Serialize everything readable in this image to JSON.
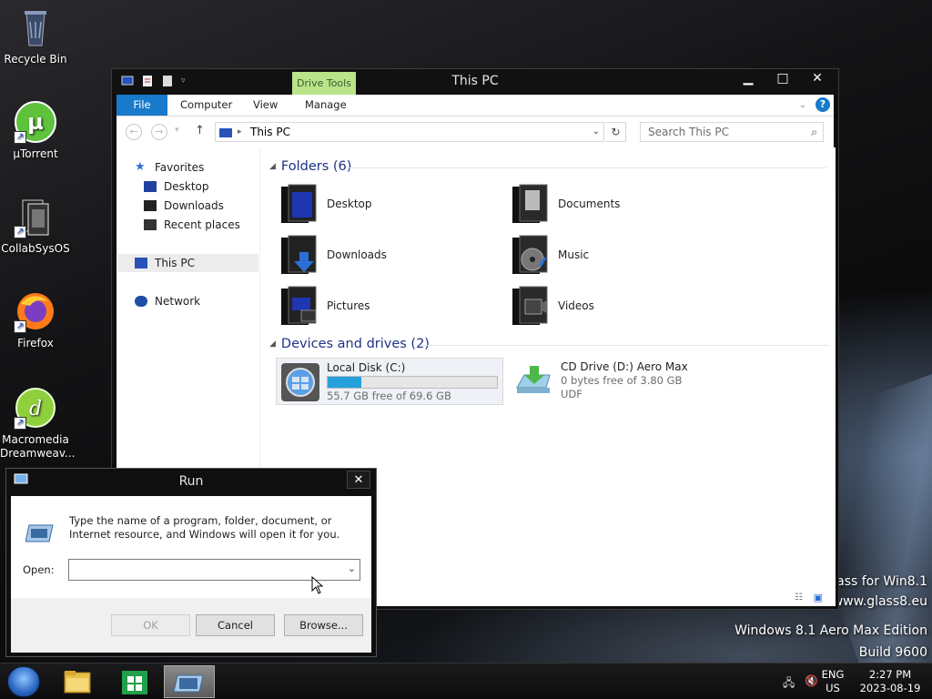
{
  "desktop": {
    "icons": [
      {
        "label": "Recycle Bin",
        "icon": "recycle-bin-icon"
      },
      {
        "label": "µTorrent",
        "icon": "utorrent-icon"
      },
      {
        "label": "CollabSysOS",
        "icon": "collabsysos-icon"
      },
      {
        "label": "Firefox",
        "icon": "firefox-icon"
      },
      {
        "label": "Macromedia Dreamweav...",
        "icon": "dreamweaver-icon"
      }
    ],
    "watermark_line1": "lass for Win8.1",
    "watermark_line2": "www.glass8.eu",
    "edition": "Windows 8.1 Aero Max Edition",
    "build": "Build 9600"
  },
  "explorer": {
    "title": "This PC",
    "context_tab": "Drive Tools",
    "ribbon_tabs": [
      "File",
      "Computer",
      "View",
      "Manage"
    ],
    "address": "This PC",
    "search_placeholder": "Search This PC",
    "nav": {
      "favorites": "Favorites",
      "desktop": "Desktop",
      "downloads": "Downloads",
      "recent": "Recent places",
      "this_pc": "This PC",
      "network": "Network"
    },
    "folders_header": "Folders (6)",
    "folders": [
      "Desktop",
      "Documents",
      "Downloads",
      "Music",
      "Pictures",
      "Videos"
    ],
    "devices_header": "Devices and drives (2)",
    "drives": [
      {
        "name": "Local Disk (C:)",
        "free": "55.7 GB free of 69.6 GB",
        "used_fraction": 0.2
      },
      {
        "name": "CD Drive (D:) Aero Max",
        "free": "0 bytes free of 3.80 GB",
        "fs": "UDF"
      }
    ]
  },
  "run": {
    "title": "Run",
    "description": "Type the name of a program, folder, document, or Internet resource, and Windows will open it for you.",
    "open_label": "Open:",
    "open_value": "",
    "ok": "OK",
    "cancel": "Cancel",
    "browse": "Browse..."
  },
  "taskbar": {
    "lang_top": "ENG",
    "lang_bottom": "US",
    "time": "2:27 PM",
    "date": "2023-08-19"
  }
}
